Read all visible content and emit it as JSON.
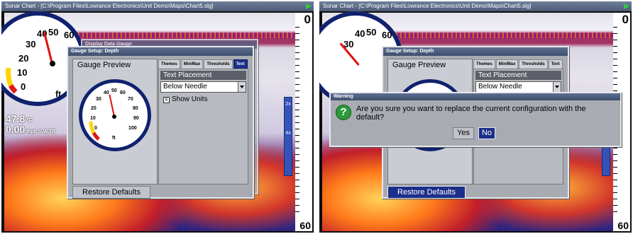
{
  "window_title": "Sonar Chart - [C:\\Program Files\\Lowrance Electronics\\Unit Demo\\Maps\\Chart5.slg]",
  "scale": {
    "top": "0",
    "bottom": "60"
  },
  "zoom_label": "2x",
  "zoom_label_lower": "4x",
  "big_gauge": {
    "labels": [
      "40",
      "50",
      "60",
      "30",
      "20",
      "10",
      "0"
    ],
    "unit": "ft"
  },
  "readouts": {
    "depth": "47.8",
    "depth_unit": "°F",
    "speed": "0.00",
    "speed_unit": "mph S.W.TR"
  },
  "background_dialog_title": "Display Data Gauge",
  "dialog": {
    "title": "Gauge Setup: Depth",
    "preview_title": "Gauge Preview",
    "preview_gauge_labels": [
      "40",
      "50",
      "60",
      "30",
      "20",
      "10",
      "0",
      "70",
      "80",
      "90",
      "100"
    ],
    "preview_unit": "ft",
    "tabs": [
      "Themes",
      "Min/Max",
      "Thresholds",
      "Text"
    ],
    "section_header": "Text Placement",
    "placement_value": "Below Needle",
    "show_units_label": "Show Units",
    "show_units_mark": "X",
    "restore_label": "Restore Defaults"
  },
  "warning": {
    "title": "Warning",
    "icon": "question-icon",
    "icon_glyph": "?",
    "message": "Are you sure you want to replace the current configuration with the default?",
    "yes_label": "Yes",
    "no_label": "No"
  },
  "colors": {
    "title_bar": "#4b5a75",
    "dialog_face": "#a8abb2",
    "focus": "#1b2f8a",
    "gauge_ring": "#10216e",
    "needle": "#d11111"
  }
}
